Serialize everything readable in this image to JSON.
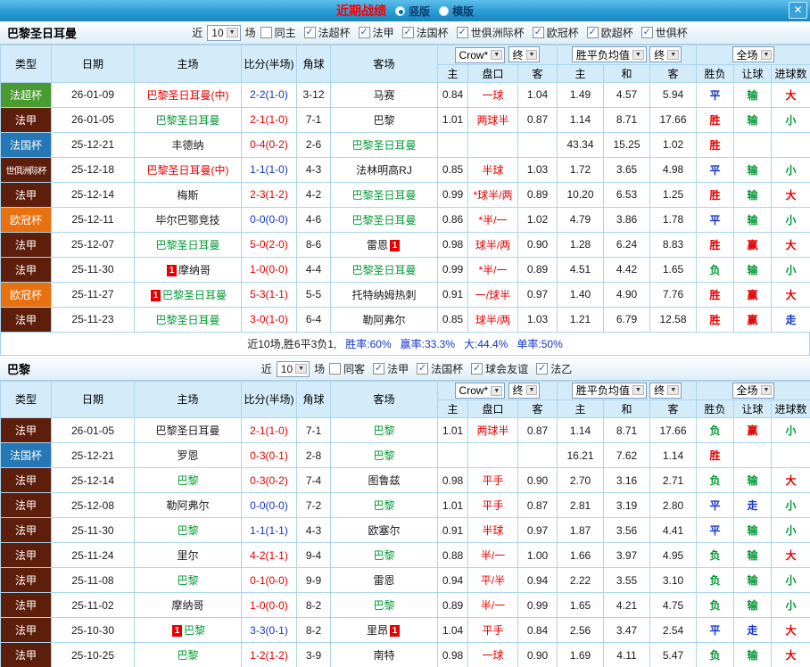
{
  "titlebar": {
    "title": "近期战绩",
    "radios": [
      {
        "label": "竖版",
        "selected": true
      },
      {
        "label": "横版",
        "selected": false
      }
    ],
    "close": "✕"
  },
  "colors": {
    "win": "#e60000",
    "draw": "#1536cc",
    "loss": "#009933",
    "header_bg": "#d4ebf9",
    "titlebar_bg": "#2b9cd4",
    "border": "#a9d5ee",
    "type_ligue1": "#5e1e0c",
    "type_supercup": "#4a9b2f",
    "type_frenchcup": "#2577b5",
    "type_ucl": "#e8700e"
  },
  "table_headers": {
    "type": "类型",
    "date": "日期",
    "home": "主场",
    "score": "比分(半场)",
    "corner": "角球",
    "away": "客场",
    "odds_group": {
      "select1": "Crow*",
      "select2": "终",
      "cols": [
        "主",
        "盘口",
        "客"
      ]
    },
    "avg_group": {
      "select1": "胜平负均值",
      "select2": "终",
      "cols": [
        "主",
        "和",
        "客"
      ]
    },
    "result_group": {
      "select": "全场",
      "cols": [
        "胜负",
        "让球",
        "进球数"
      ]
    }
  },
  "sections": [
    {
      "team": "巴黎圣日耳曼",
      "filters": {
        "near": "近",
        "count": "10",
        "games": "场",
        "checkboxes": [
          {
            "label": "同主",
            "checked": false
          },
          {
            "label": "法超杯",
            "checked": true
          },
          {
            "label": "法甲",
            "checked": true
          },
          {
            "label": "法国杯",
            "checked": true
          },
          {
            "label": "世俱洲际杯",
            "checked": true
          },
          {
            "label": "欧冠杯",
            "checked": true
          },
          {
            "label": "欧超杯",
            "checked": true
          },
          {
            "label": "世俱杯",
            "checked": true
          }
        ]
      },
      "rows": [
        {
          "type": "法超杯",
          "tc": "#4a9b2f",
          "date": "26-01-09",
          "home": {
            "name": "巴黎圣日耳曼(中)",
            "color": "red"
          },
          "score": {
            "text": "2-2(1-0)",
            "color": "blue"
          },
          "corner": "3-12",
          "away": {
            "name": "马赛",
            "color": "black"
          },
          "odds": [
            "0.84",
            "一球",
            "1.04"
          ],
          "avg": [
            "1.49",
            "4.57",
            "5.94"
          ],
          "res": [
            "平",
            "blue"
          ],
          "han": [
            "输",
            "green"
          ],
          "goal": [
            "大",
            "red"
          ]
        },
        {
          "type": "法甲",
          "tc": "#5e1e0c",
          "date": "26-01-05",
          "home": {
            "name": "巴黎圣日耳曼",
            "color": "green"
          },
          "score": {
            "text": "2-1(1-0)",
            "color": "red"
          },
          "corner": "7-1",
          "away": {
            "name": "巴黎",
            "color": "black"
          },
          "odds": [
            "1.01",
            "两球半",
            "0.87"
          ],
          "avg": [
            "1.14",
            "8.71",
            "17.66"
          ],
          "res": [
            "胜",
            "red"
          ],
          "han": [
            "输",
            "green"
          ],
          "goal": [
            "小",
            "green"
          ]
        },
        {
          "type": "法国杯",
          "tc": "#2577b5",
          "date": "25-12-21",
          "home": {
            "name": "丰德纳",
            "color": "black"
          },
          "score": {
            "text": "0-4(0-2)",
            "color": "red"
          },
          "corner": "2-6",
          "away": {
            "name": "巴黎圣日耳曼",
            "color": "green"
          },
          "odds": [
            "",
            "",
            ""
          ],
          "avg": [
            "43.34",
            "15.25",
            "1.02"
          ],
          "res": [
            "胜",
            "red"
          ],
          "han": [
            "",
            "black"
          ],
          "goal": [
            "",
            "black"
          ]
        },
        {
          "type": "世俱洲际杯",
          "tc": "#5e1e0c",
          "date": "25-12-18",
          "home": {
            "name": "巴黎圣日耳曼(中)",
            "color": "red"
          },
          "score": {
            "text": "1-1(1-0)",
            "color": "blue"
          },
          "corner": "4-3",
          "away": {
            "name": "法林明高RJ",
            "color": "black"
          },
          "odds": [
            "0.85",
            "半球",
            "1.03"
          ],
          "avg": [
            "1.72",
            "3.65",
            "4.98"
          ],
          "res": [
            "平",
            "blue"
          ],
          "han": [
            "输",
            "green"
          ],
          "goal": [
            "小",
            "green"
          ]
        },
        {
          "type": "法甲",
          "tc": "#5e1e0c",
          "date": "25-12-14",
          "home": {
            "name": "梅斯",
            "color": "black"
          },
          "score": {
            "text": "2-3(1-2)",
            "color": "red"
          },
          "corner": "4-2",
          "away": {
            "name": "巴黎圣日耳曼",
            "color": "green"
          },
          "odds": [
            "0.99",
            "*球半/两",
            "0.89"
          ],
          "avg": [
            "10.20",
            "6.53",
            "1.25"
          ],
          "res": [
            "胜",
            "red"
          ],
          "han": [
            "输",
            "green"
          ],
          "goal": [
            "大",
            "red"
          ]
        },
        {
          "type": "欧冠杯",
          "tc": "#e8700e",
          "date": "25-12-11",
          "home": {
            "name": "毕尔巴鄂竞技",
            "color": "black"
          },
          "score": {
            "text": "0-0(0-0)",
            "color": "blue"
          },
          "corner": "4-6",
          "away": {
            "name": "巴黎圣日耳曼",
            "color": "green"
          },
          "odds": [
            "0.86",
            "*半/一",
            "1.02"
          ],
          "avg": [
            "4.79",
            "3.86",
            "1.78"
          ],
          "res": [
            "平",
            "blue"
          ],
          "han": [
            "输",
            "green"
          ],
          "goal": [
            "小",
            "green"
          ]
        },
        {
          "type": "法甲",
          "tc": "#5e1e0c",
          "date": "25-12-07",
          "home": {
            "name": "巴黎圣日耳曼",
            "color": "green"
          },
          "score": {
            "text": "5-0(2-0)",
            "color": "red"
          },
          "corner": "8-6",
          "away": {
            "name": "雷恩",
            "color": "black",
            "badge": "1",
            "badge_pos": "after"
          },
          "odds": [
            "0.98",
            "球半/两",
            "0.90"
          ],
          "avg": [
            "1.28",
            "6.24",
            "8.83"
          ],
          "res": [
            "胜",
            "red"
          ],
          "han": [
            "赢",
            "red"
          ],
          "goal": [
            "大",
            "red"
          ]
        },
        {
          "type": "法甲",
          "tc": "#5e1e0c",
          "date": "25-11-30",
          "home": {
            "name": "摩纳哥",
            "color": "black",
            "badge": "1",
            "badge_pos": "before"
          },
          "score": {
            "text": "1-0(0-0)",
            "color": "red"
          },
          "corner": "4-4",
          "away": {
            "name": "巴黎圣日耳曼",
            "color": "green"
          },
          "odds": [
            "0.99",
            "*半/一",
            "0.89"
          ],
          "avg": [
            "4.51",
            "4.42",
            "1.65"
          ],
          "res": [
            "负",
            "green"
          ],
          "han": [
            "输",
            "green"
          ],
          "goal": [
            "小",
            "green"
          ]
        },
        {
          "type": "欧冠杯",
          "tc": "#e8700e",
          "date": "25-11-27",
          "home": {
            "name": "巴黎圣日耳曼",
            "color": "green",
            "badge": "1",
            "badge_pos": "before"
          },
          "score": {
            "text": "5-3(1-1)",
            "color": "red"
          },
          "corner": "5-5",
          "away": {
            "name": "托特纳姆热刺",
            "color": "black"
          },
          "odds": [
            "0.91",
            "一/球半",
            "0.97"
          ],
          "avg": [
            "1.40",
            "4.90",
            "7.76"
          ],
          "res": [
            "胜",
            "red"
          ],
          "han": [
            "赢",
            "red"
          ],
          "goal": [
            "大",
            "red"
          ]
        },
        {
          "type": "法甲",
          "tc": "#5e1e0c",
          "date": "25-11-23",
          "home": {
            "name": "巴黎圣日耳曼",
            "color": "green"
          },
          "score": {
            "text": "3-0(1-0)",
            "color": "red"
          },
          "corner": "6-4",
          "away": {
            "name": "勒阿弗尔",
            "color": "black"
          },
          "odds": [
            "0.85",
            "球半/两",
            "1.03"
          ],
          "avg": [
            "1.21",
            "6.79",
            "12.58"
          ],
          "res": [
            "胜",
            "red"
          ],
          "han": [
            "赢",
            "red"
          ],
          "goal": [
            "走",
            "blue"
          ]
        }
      ],
      "summary": [
        {
          "text": "近10场,胜6平3负1,",
          "color": "black"
        },
        {
          "text": "胜率:60%",
          "color": "blue"
        },
        {
          "text": "赢率:33.3%",
          "color": "blue"
        },
        {
          "text": "大:44.4%",
          "color": "blue"
        },
        {
          "text": "单率:50%",
          "color": "blue"
        }
      ]
    },
    {
      "team": "巴黎",
      "filters": {
        "near": "近",
        "count": "10",
        "games": "场",
        "checkboxes": [
          {
            "label": "同客",
            "checked": false
          },
          {
            "label": "法甲",
            "checked": true
          },
          {
            "label": "法国杯",
            "checked": true
          },
          {
            "label": "球会友谊",
            "checked": true
          },
          {
            "label": "法乙",
            "checked": true
          }
        ]
      },
      "rows": [
        {
          "type": "法甲",
          "tc": "#5e1e0c",
          "date": "26-01-05",
          "home": {
            "name": "巴黎圣日耳曼",
            "color": "black"
          },
          "score": {
            "text": "2-1(1-0)",
            "color": "red"
          },
          "corner": "7-1",
          "away": {
            "name": "巴黎",
            "color": "green"
          },
          "odds": [
            "1.01",
            "两球半",
            "0.87"
          ],
          "avg": [
            "1.14",
            "8.71",
            "17.66"
          ],
          "res": [
            "负",
            "green"
          ],
          "han": [
            "赢",
            "red"
          ],
          "goal": [
            "小",
            "green"
          ]
        },
        {
          "type": "法国杯",
          "tc": "#2577b5",
          "date": "25-12-21",
          "home": {
            "name": "罗恩",
            "color": "black"
          },
          "score": {
            "text": "0-3(0-1)",
            "color": "red"
          },
          "corner": "2-8",
          "away": {
            "name": "巴黎",
            "color": "green"
          },
          "odds": [
            "",
            "",
            ""
          ],
          "avg": [
            "16.21",
            "7.62",
            "1.14"
          ],
          "res": [
            "胜",
            "red"
          ],
          "han": [
            "",
            "black"
          ],
          "goal": [
            "",
            "black"
          ]
        },
        {
          "type": "法甲",
          "tc": "#5e1e0c",
          "date": "25-12-14",
          "home": {
            "name": "巴黎",
            "color": "green"
          },
          "score": {
            "text": "0-3(0-2)",
            "color": "red"
          },
          "corner": "7-4",
          "away": {
            "name": "图鲁兹",
            "color": "black"
          },
          "odds": [
            "0.98",
            "平手",
            "0.90"
          ],
          "avg": [
            "2.70",
            "3.16",
            "2.71"
          ],
          "res": [
            "负",
            "green"
          ],
          "han": [
            "输",
            "green"
          ],
          "goal": [
            "大",
            "red"
          ]
        },
        {
          "type": "法甲",
          "tc": "#5e1e0c",
          "date": "25-12-08",
          "home": {
            "name": "勒阿弗尔",
            "color": "black"
          },
          "score": {
            "text": "0-0(0-0)",
            "color": "blue"
          },
          "corner": "7-2",
          "away": {
            "name": "巴黎",
            "color": "green"
          },
          "odds": [
            "1.01",
            "平手",
            "0.87"
          ],
          "avg": [
            "2.81",
            "3.19",
            "2.80"
          ],
          "res": [
            "平",
            "blue"
          ],
          "han": [
            "走",
            "blue"
          ],
          "goal": [
            "小",
            "green"
          ]
        },
        {
          "type": "法甲",
          "tc": "#5e1e0c",
          "date": "25-11-30",
          "home": {
            "name": "巴黎",
            "color": "green"
          },
          "score": {
            "text": "1-1(1-1)",
            "color": "blue"
          },
          "corner": "4-3",
          "away": {
            "name": "欧塞尔",
            "color": "black"
          },
          "odds": [
            "0.91",
            "半球",
            "0.97"
          ],
          "avg": [
            "1.87",
            "3.56",
            "4.41"
          ],
          "res": [
            "平",
            "blue"
          ],
          "han": [
            "输",
            "green"
          ],
          "goal": [
            "小",
            "green"
          ]
        },
        {
          "type": "法甲",
          "tc": "#5e1e0c",
          "date": "25-11-24",
          "home": {
            "name": "里尔",
            "color": "black"
          },
          "score": {
            "text": "4-2(1-1)",
            "color": "red"
          },
          "corner": "9-4",
          "away": {
            "name": "巴黎",
            "color": "green"
          },
          "odds": [
            "0.88",
            "半/一",
            "1.00"
          ],
          "avg": [
            "1.66",
            "3.97",
            "4.95"
          ],
          "res": [
            "负",
            "green"
          ],
          "han": [
            "输",
            "green"
          ],
          "goal": [
            "大",
            "red"
          ]
        },
        {
          "type": "法甲",
          "tc": "#5e1e0c",
          "date": "25-11-08",
          "home": {
            "name": "巴黎",
            "color": "green"
          },
          "score": {
            "text": "0-1(0-0)",
            "color": "red"
          },
          "corner": "9-9",
          "away": {
            "name": "雷恩",
            "color": "black"
          },
          "odds": [
            "0.94",
            "平/半",
            "0.94"
          ],
          "avg": [
            "2.22",
            "3.55",
            "3.10"
          ],
          "res": [
            "负",
            "green"
          ],
          "han": [
            "输",
            "green"
          ],
          "goal": [
            "小",
            "green"
          ]
        },
        {
          "type": "法甲",
          "tc": "#5e1e0c",
          "date": "25-11-02",
          "home": {
            "name": "摩纳哥",
            "color": "black"
          },
          "score": {
            "text": "1-0(0-0)",
            "color": "red"
          },
          "corner": "8-2",
          "away": {
            "name": "巴黎",
            "color": "green"
          },
          "odds": [
            "0.89",
            "半/一",
            "0.99"
          ],
          "avg": [
            "1.65",
            "4.21",
            "4.75"
          ],
          "res": [
            "负",
            "green"
          ],
          "han": [
            "输",
            "green"
          ],
          "goal": [
            "小",
            "green"
          ]
        },
        {
          "type": "法甲",
          "tc": "#5e1e0c",
          "date": "25-10-30",
          "home": {
            "name": "巴黎",
            "color": "green",
            "badge": "1",
            "badge_pos": "before"
          },
          "score": {
            "text": "3-3(0-1)",
            "color": "blue"
          },
          "corner": "8-2",
          "away": {
            "name": "里昂",
            "color": "black",
            "badge": "1",
            "badge_pos": "after"
          },
          "odds": [
            "1.04",
            "平手",
            "0.84"
          ],
          "avg": [
            "2.56",
            "3.47",
            "2.54"
          ],
          "res": [
            "平",
            "blue"
          ],
          "han": [
            "走",
            "blue"
          ],
          "goal": [
            "大",
            "red"
          ]
        },
        {
          "type": "法甲",
          "tc": "#5e1e0c",
          "date": "25-10-25",
          "home": {
            "name": "巴黎",
            "color": "green"
          },
          "score": {
            "text": "1-2(1-2)",
            "color": "red"
          },
          "corner": "3-9",
          "away": {
            "name": "南特",
            "color": "black"
          },
          "odds": [
            "0.98",
            "一球",
            "0.90"
          ],
          "avg": [
            "1.69",
            "4.11",
            "5.47"
          ],
          "res": [
            "负",
            "green"
          ],
          "han": [
            "输",
            "green"
          ],
          "goal": [
            "大",
            "red"
          ]
        }
      ]
    }
  ]
}
